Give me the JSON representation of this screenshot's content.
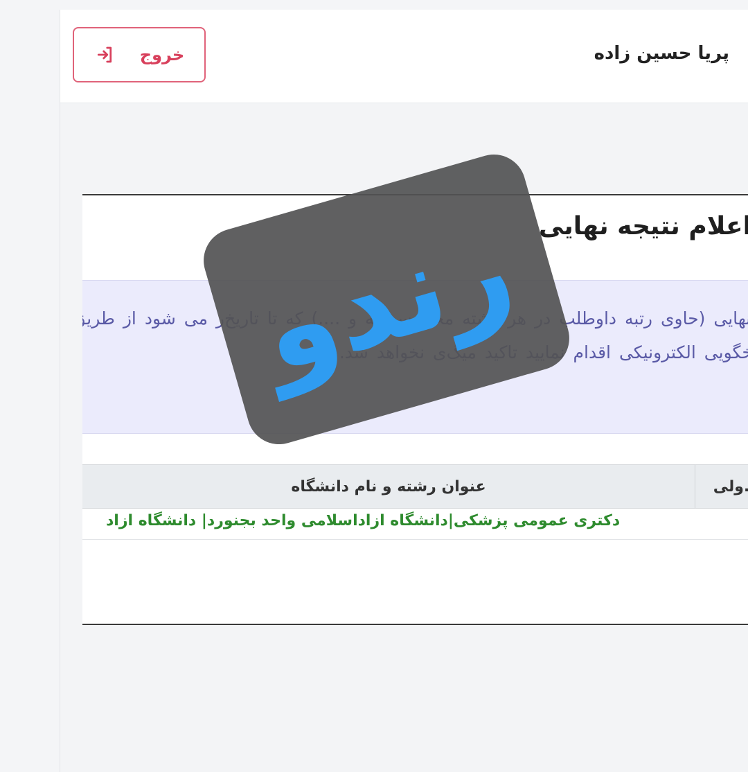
{
  "header": {
    "logout_label": "خروج",
    "user_name": "پریا حسین زاده"
  },
  "card": {
    "title": "اعلام نتیجه نهایی",
    "notice_text": "مه نهایی (حاوی رتبه داوطلب در هر رشته محل سهمیه و ....) که تا تاریخ‌ر می شود از طریق سیستم پاسخگویی الکترونیکی اقدام نمایید تاکید میگ‌ی نخواهد شد."
  },
  "table": {
    "headers": [
      "...ولی",
      "عنوان رشته و نام دانشگاه"
    ],
    "rows": [
      {
        "field_university": "دکتری عمومی پزشکی|دانشگاه ازاداسلامی واحد بجنورد| دانشگاه ازاد"
      }
    ]
  },
  "watermark": {
    "text": "رندو",
    "colors": {
      "badge": "#525254",
      "text": "#2f9cf1"
    }
  },
  "colors": {
    "accent_red": "#d8405c",
    "success_green": "#2e8b2e",
    "notice_text": "#5a5aa6"
  },
  "icons": {
    "logout": "logout-icon"
  }
}
